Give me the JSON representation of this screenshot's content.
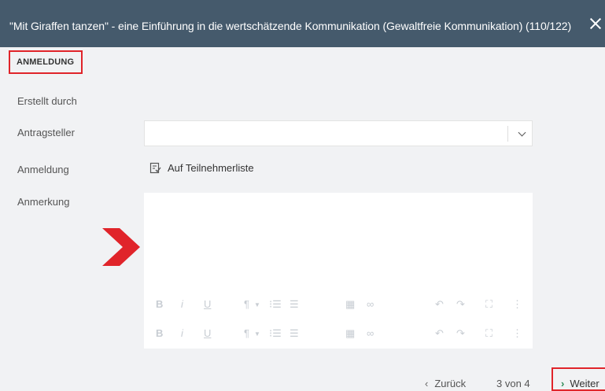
{
  "window": {
    "title": "\"Mit Giraffen tanzen\" - eine Einführung in die wertschätzende Kommunikation (Gewaltfreie Kommunikation) (110/122)",
    "close_icon": "close-icon"
  },
  "section": {
    "tab_label": "ANMELDUNG"
  },
  "form": {
    "created_by_label": "Erstellt durch",
    "applicant_label": "Antragsteller",
    "applicant_value": "",
    "registration_label": "Anmeldung",
    "registration_value": "Auf Teilnehmerliste",
    "note_label": "Anmerkung",
    "note_value": ""
  },
  "editor_toolbar": {
    "bold": "B",
    "italic": "i",
    "underline": "U",
    "paragraph": "¶",
    "ordered_list": "⁝☰",
    "unordered_list": "☰",
    "table": "▦",
    "link": "∞",
    "undo": "↶",
    "redo": "↷",
    "fullscreen": "⛶",
    "more": "⋮"
  },
  "pager": {
    "back_label": "Zurück",
    "back_icon": "‹",
    "position": "3 von 4",
    "next_label": "Weiter",
    "next_icon": "›"
  },
  "colors": {
    "titlebar": "#455a6c",
    "highlight": "#e0242a",
    "accent_green": "#2e8b57"
  }
}
